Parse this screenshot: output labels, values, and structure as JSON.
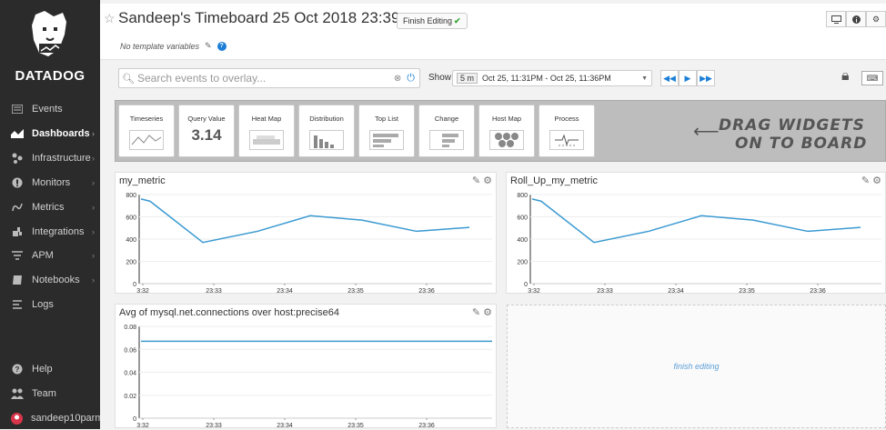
{
  "sidebar": {
    "brand": "DATADOG",
    "items": [
      {
        "label": "Events",
        "icon": "events-icon",
        "chevron": false
      },
      {
        "label": "Dashboards",
        "icon": "dashboards-icon",
        "chevron": true,
        "active": true
      },
      {
        "label": "Infrastructure",
        "icon": "infrastructure-icon",
        "chevron": true
      },
      {
        "label": "Monitors",
        "icon": "monitors-icon",
        "chevron": true
      },
      {
        "label": "Metrics",
        "icon": "metrics-icon",
        "chevron": true
      },
      {
        "label": "Integrations",
        "icon": "integrations-icon",
        "chevron": true
      },
      {
        "label": "APM",
        "icon": "apm-icon",
        "chevron": true
      },
      {
        "label": "Notebooks",
        "icon": "notebooks-icon",
        "chevron": true
      },
      {
        "label": "Logs",
        "icon": "logs-icon",
        "chevron": false
      }
    ],
    "bottom_items": [
      {
        "label": "Help",
        "icon": "help-icon"
      },
      {
        "label": "Team",
        "icon": "team-icon"
      },
      {
        "label": "sandeep10parm...",
        "icon": "avatar"
      }
    ]
  },
  "header": {
    "title": "Sandeep's Timeboard 25 Oct 2018 23:39",
    "finish_button": "Finish Editing",
    "template_vars": "No template variables"
  },
  "toolbar": {
    "search_placeholder": "Search events to overlay...",
    "show_label": "Show",
    "span": "5 m",
    "range": "Oct 25, 11:31PM - Oct 25, 11:36PM"
  },
  "widget_tray": {
    "widgets": [
      {
        "label": "Timeseries"
      },
      {
        "label": "Query Value",
        "value": "3.14"
      },
      {
        "label": "Heat Map"
      },
      {
        "label": "Distribution"
      },
      {
        "label": "Top List"
      },
      {
        "label": "Change"
      },
      {
        "label": "Host Map"
      },
      {
        "label": "Process"
      }
    ],
    "drag_text_line1": "Drag widgets",
    "drag_text_line2": "on to board"
  },
  "placeholder": {
    "text": "finish editing"
  },
  "colors": {
    "line": "#3b9ad2",
    "sidebar": "#2b2b2b",
    "accent": "#1c7fd6"
  },
  "chart_data": [
    {
      "type": "line",
      "title": "my_metric",
      "x_ticks": [
        "3:32",
        "23:33",
        "23:34",
        "23:35",
        "23:36"
      ],
      "y_ticks": [
        "0",
        "200",
        "400",
        "600",
        "800"
      ],
      "ylim": [
        0,
        800
      ],
      "series": [
        {
          "values": [
            760,
            740,
            370,
            470,
            610,
            570,
            470,
            505
          ]
        }
      ]
    },
    {
      "type": "line",
      "title": "Roll_Up_my_metric",
      "x_ticks": [
        "3:32",
        "23:33",
        "23:34",
        "23:35",
        "23:36"
      ],
      "y_ticks": [
        "0",
        "200",
        "400",
        "600",
        "800"
      ],
      "ylim": [
        0,
        800
      ],
      "series": [
        {
          "values": [
            760,
            740,
            370,
            470,
            610,
            570,
            470,
            505
          ]
        }
      ]
    },
    {
      "type": "line",
      "title": "Avg of mysql.net.connections over host:precise64",
      "x_ticks": [
        "3:32",
        "23:33",
        "23:34",
        "23:35",
        "23:36"
      ],
      "y_ticks": [
        "0",
        "0.02",
        "0.04",
        "0.06",
        "0.08"
      ],
      "ylim": [
        0,
        0.08
      ],
      "series": [
        {
          "values": [
            0.067,
            0.067,
            0.067,
            0.067,
            0.067,
            0.067,
            0.067,
            0.067,
            0.067,
            0.067
          ]
        }
      ]
    }
  ]
}
